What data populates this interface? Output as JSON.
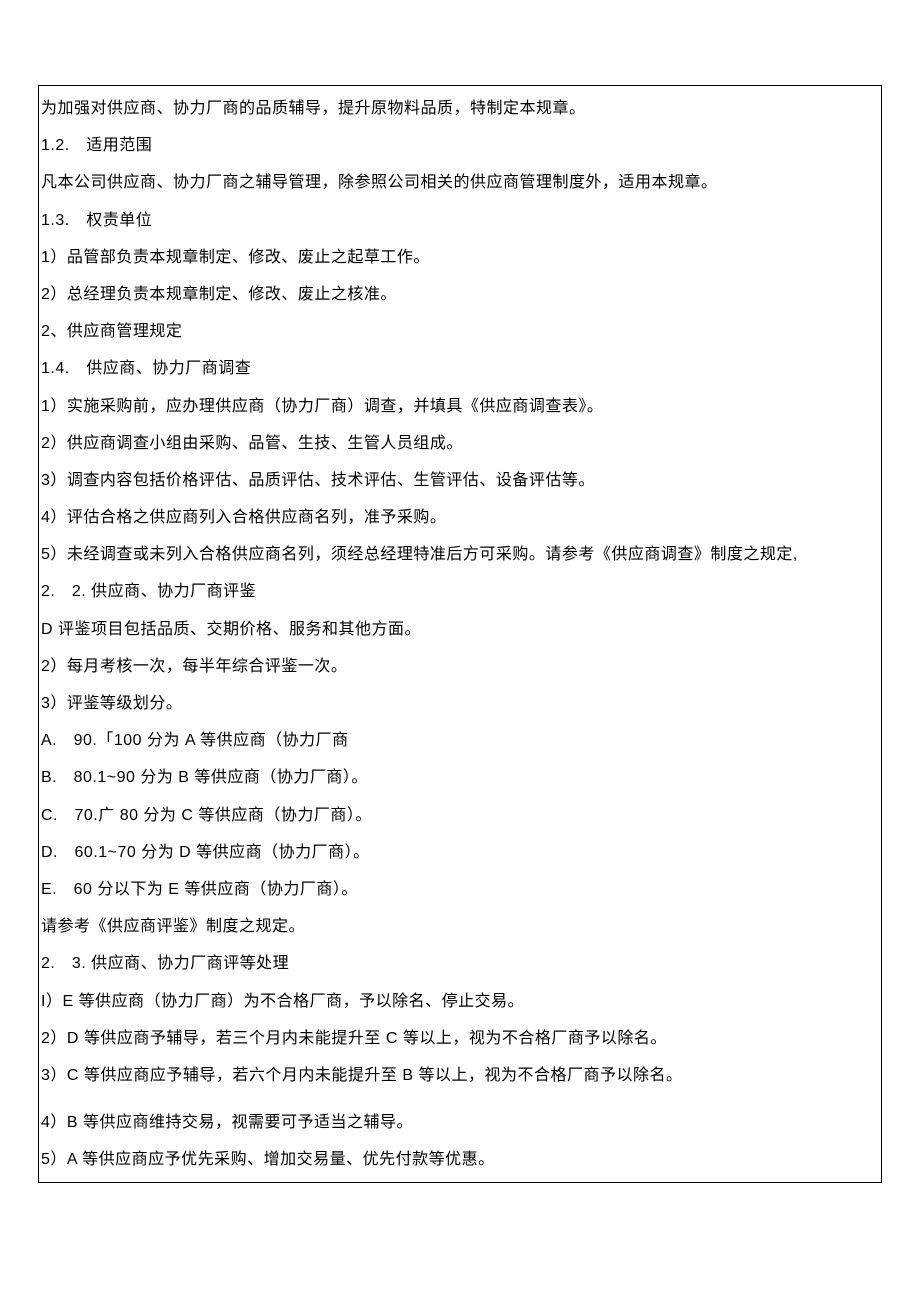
{
  "lines": {
    "l0": "为加强对供应商、协力厂商的品质辅导，提升原物料品质，特制定本规章。",
    "l1": "1.2. 适用范围",
    "l2": "凡本公司供应商、协力厂商之辅导管理，除参照公司相关的供应商管理制度外，适用本规章。",
    "l3": "1.3. 权责单位",
    "l4": "1）品管部负责本规章制定、修改、废止之起草工作。",
    "l5": "2）总经理负责本规章制定、修改、废止之核准。",
    "l6": "2、供应商管理规定",
    "l7": "1.4. 供应商、协力厂商调查",
    "l8": "1）实施采购前，应办理供应商（协力厂商）调查，并填具《供应商调查表》。",
    "l9": "2）供应商调查小组由采购、品管、生技、生管人员组成。",
    "l10": "3）调查内容包括价格评估、品质评估、技术评估、生管评估、设备评估等。",
    "l11": "4）评估合格之供应商列入合格供应商名列，准予采购。",
    "l12": "5）未经调查或未列入合格供应商名列，须经总经理特准后方可采购。请参考《供应商调查》制度之规定,",
    "l13": "2. 2. 供应商、协力厂商评鉴",
    "l14": "D 评鉴项目包括品质、交期价格、服务和其他方面。",
    "l15": "2）每月考核一次，每半年综合评鉴一次。",
    "l16": "3）评鉴等级划分。",
    "l17": "A. 90.「100 分为 A 等供应商（协力厂商",
    "l18": "B. 80.1~90 分为 B 等供应商（协力厂商）。",
    "l19": "C. 70.广 80 分为 C 等供应商（协力厂商）。",
    "l20": "D. 60.1~70 分为 D 等供应商（协力厂商）。",
    "l21": "E. 60 分以下为 E 等供应商（协力厂商）。",
    "l22": "请参考《供应商评鉴》制度之规定。",
    "l23": "2. 3. 供应商、协力厂商评等处理",
    "l24": "I）E 等供应商（协力厂商）为不合格厂商，予以除名、停止交易。",
    "l25": "2）D 等供应商予辅导，若三个月内未能提升至 C 等以上，视为不合格厂商予以除名。",
    "l26": "3）C 等供应商应予辅导，若六个月内未能提升至 B 等以上，视为不合格厂商予以除名。",
    "l27": "4）B 等供应商维持交易，视需要可予适当之辅导。",
    "l28": "5）A 等供应商应予优先采购、增加交易量、优先付款等优惠。"
  }
}
